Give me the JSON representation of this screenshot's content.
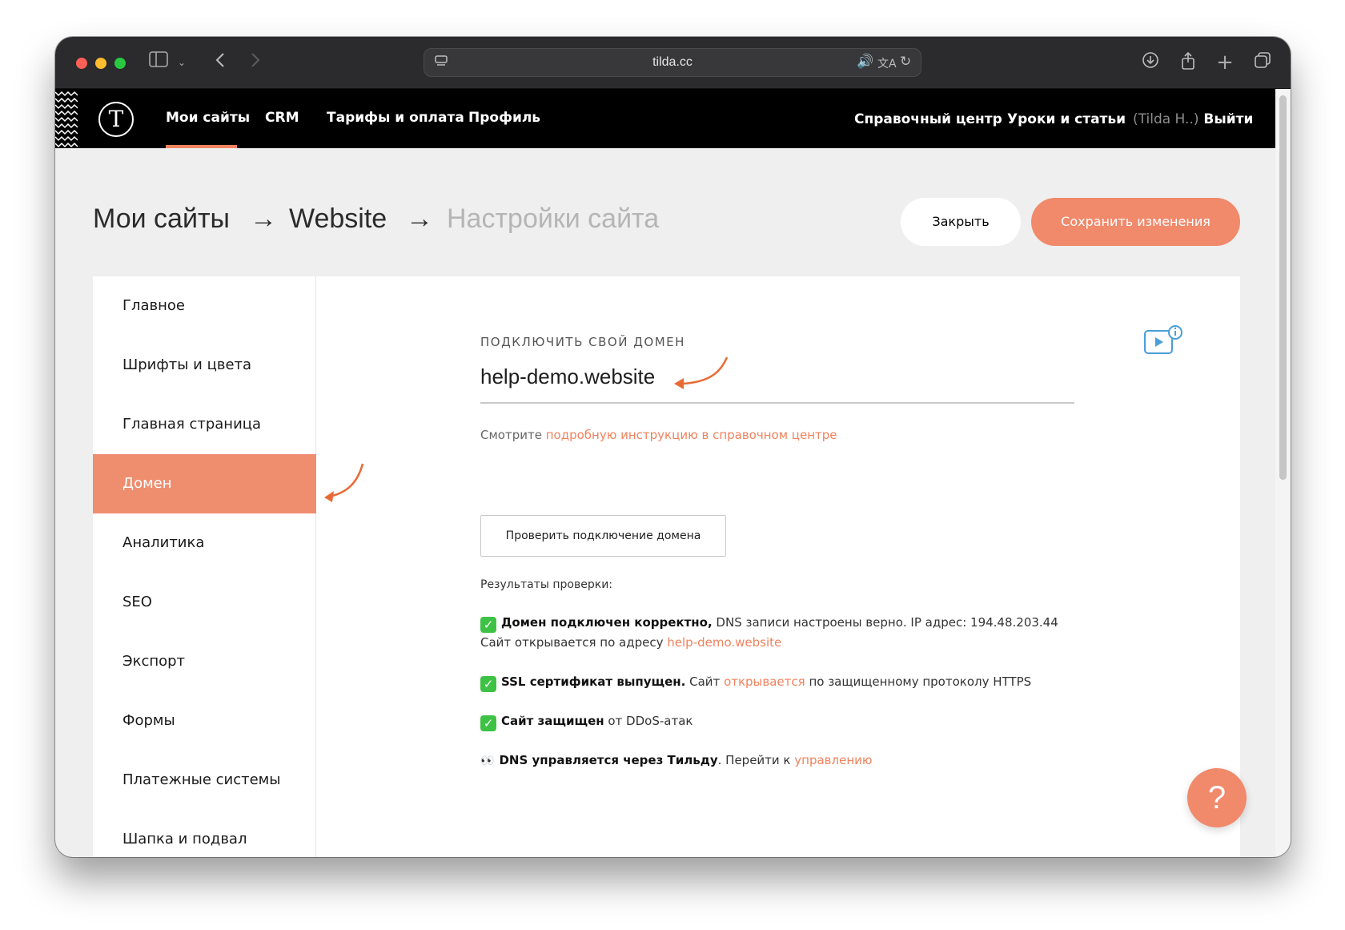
{
  "browser": {
    "url": "tilda.cc"
  },
  "nav": {
    "logo": "T",
    "links": [
      "Мои сайты",
      "CRM",
      "Тарифы и оплата",
      "Профиль"
    ],
    "right": {
      "help_center": "Справочный центр",
      "lessons": "Уроки и статьи",
      "user": "(Tilda H..)",
      "logout": "Выйти"
    }
  },
  "breadcrumb": {
    "items": [
      "Мои сайты",
      "Website",
      "Настройки сайта"
    ],
    "separator": "→"
  },
  "actions": {
    "close": "Закрыть",
    "save": "Сохранить изменения"
  },
  "sidebar": {
    "items": [
      {
        "label": "Главное"
      },
      {
        "label": "Шрифты и цвета"
      },
      {
        "label": "Главная страница"
      },
      {
        "label": "Домен",
        "active": true
      },
      {
        "label": "Аналитика"
      },
      {
        "label": "SEO"
      },
      {
        "label": "Экспорт"
      },
      {
        "label": "Формы"
      },
      {
        "label": "Платежные системы"
      },
      {
        "label": "Шапка и подвал"
      }
    ]
  },
  "domain": {
    "label": "ПОДКЛЮЧИТЬ СВОЙ ДОМЕН",
    "value": "help-demo.website",
    "hint_prefix": "Смотрите",
    "hint_link": "подробную инструкцию в справочном центре",
    "check_button": "Проверить подключение домена",
    "results_title": "Результаты проверки:"
  },
  "results": {
    "r1": {
      "bold": "Домен подключен корректно,",
      "text": " DNS записи настроены верно. IP адрес: 194.48.203.44",
      "line2_prefix": "Сайт открывается по адресу",
      "line2_link": "help-demo.website"
    },
    "r2": {
      "bold": "SSL сертификат выпущен.",
      "text_before": " Сайт",
      "link": "открывается",
      "text_after": " по защищенному протоколу HTTPS"
    },
    "r3": {
      "bold": "Сайт защищен",
      "text": " от DDoS-атак"
    },
    "r4": {
      "bold": "DNS управляется через Тильду",
      "text": ". Перейти к",
      "link": "управлению"
    }
  },
  "help_button": "?",
  "colors": {
    "accent": "#f1896b",
    "nav_bg": "#000000",
    "check_green": "#3ec246",
    "annotation_arrow": "#ea6a35"
  },
  "icons": {
    "check": "✓",
    "eyes": "👀"
  }
}
